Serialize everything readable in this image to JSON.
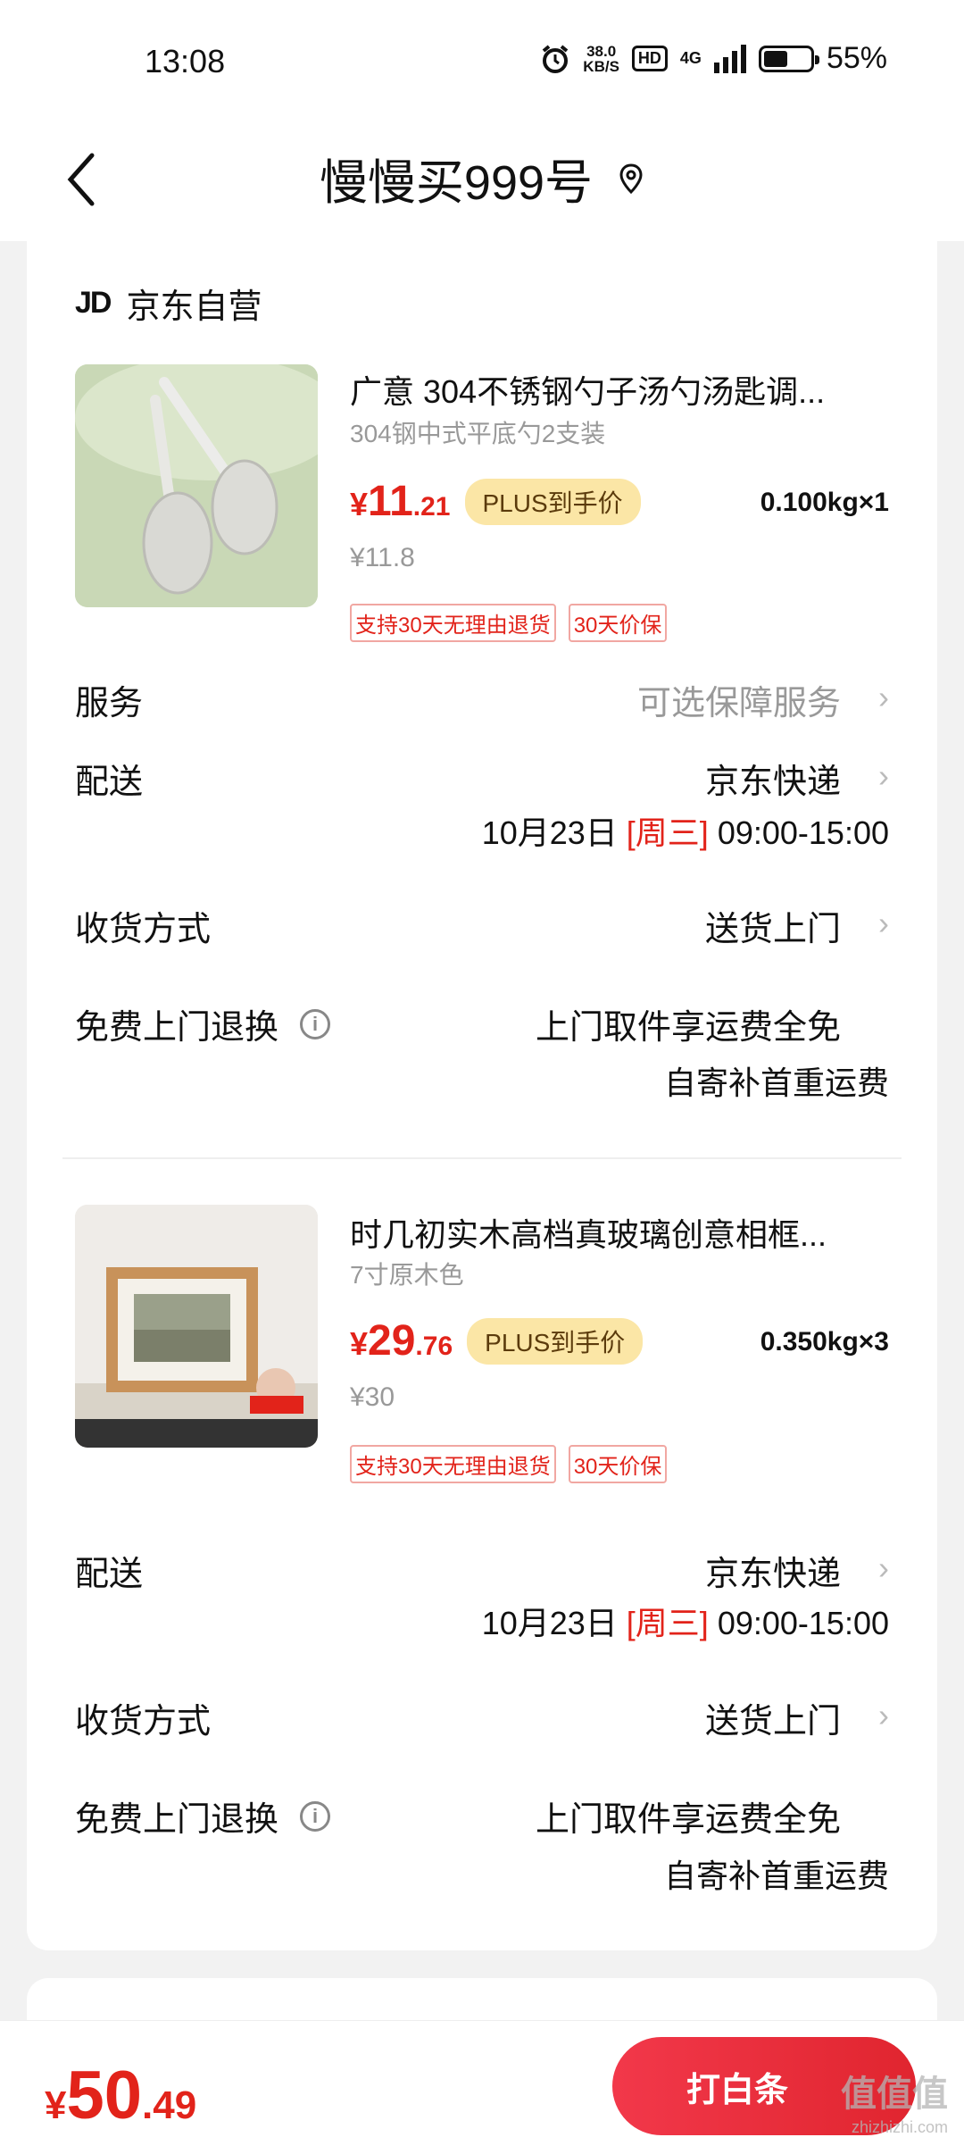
{
  "status_bar": {
    "time": "13:08",
    "net_speed_top": "38.0",
    "net_speed_bottom": "KB/S",
    "hd": "HD",
    "network": "4G",
    "battery": "55%"
  },
  "header": {
    "title": "慢慢买999号"
  },
  "shop": {
    "logo": "JD",
    "name": "京东自营"
  },
  "items": [
    {
      "title": "广意 304不锈钢勺子汤勺汤匙调...",
      "spec": "304钢中式平底勺2支装",
      "price_yen": "¥",
      "price_int": "11",
      "price_dec": ".21",
      "plus_label": "PLUS到手价",
      "weight": "0.100kg×1",
      "orig_price": "¥11.8",
      "tags": [
        "支持30天无理由退货",
        "30天价保"
      ]
    },
    {
      "title": "时几初实木高档真玻璃创意相框...",
      "spec": "7寸原木色",
      "price_yen": "¥",
      "price_int": "29",
      "price_dec": ".76",
      "plus_label": "PLUS到手价",
      "weight": "0.350kg×3",
      "orig_price": "¥30",
      "tags": [
        "支持30天无理由退货",
        "30天价保"
      ]
    }
  ],
  "rows1": {
    "service_label": "服务",
    "service_value": "可选保障服务",
    "delivery_label": "配送",
    "delivery_value": "京东快递",
    "delivery_date": "10月23日",
    "delivery_weekday": "[周三]",
    "delivery_time": "09:00-15:00",
    "receive_label": "收货方式",
    "receive_value": "送货上门",
    "return_label": "免费上门退换",
    "return_line1": "上门取件享运费全免",
    "return_line2": "自寄补首重运费"
  },
  "rows2": {
    "delivery_label": "配送",
    "delivery_value": "京东快递",
    "delivery_date": "10月23日",
    "delivery_weekday": "[周三]",
    "delivery_time": "09:00-15:00",
    "receive_label": "收货方式",
    "receive_value": "送货上门",
    "return_label": "免费上门退换",
    "return_line1": "上门取件享运费全免",
    "return_line2": "自寄补首重运费"
  },
  "bottom": {
    "total_yen": "¥",
    "total_int": "50",
    "total_dec": ".49",
    "pay_label": "打白条"
  },
  "watermark": {
    "text": "值值值",
    "sub": "zhizhizhi.com"
  },
  "colors": {
    "accent": "#e2231a",
    "plus_badge": "#fbe6a6"
  }
}
